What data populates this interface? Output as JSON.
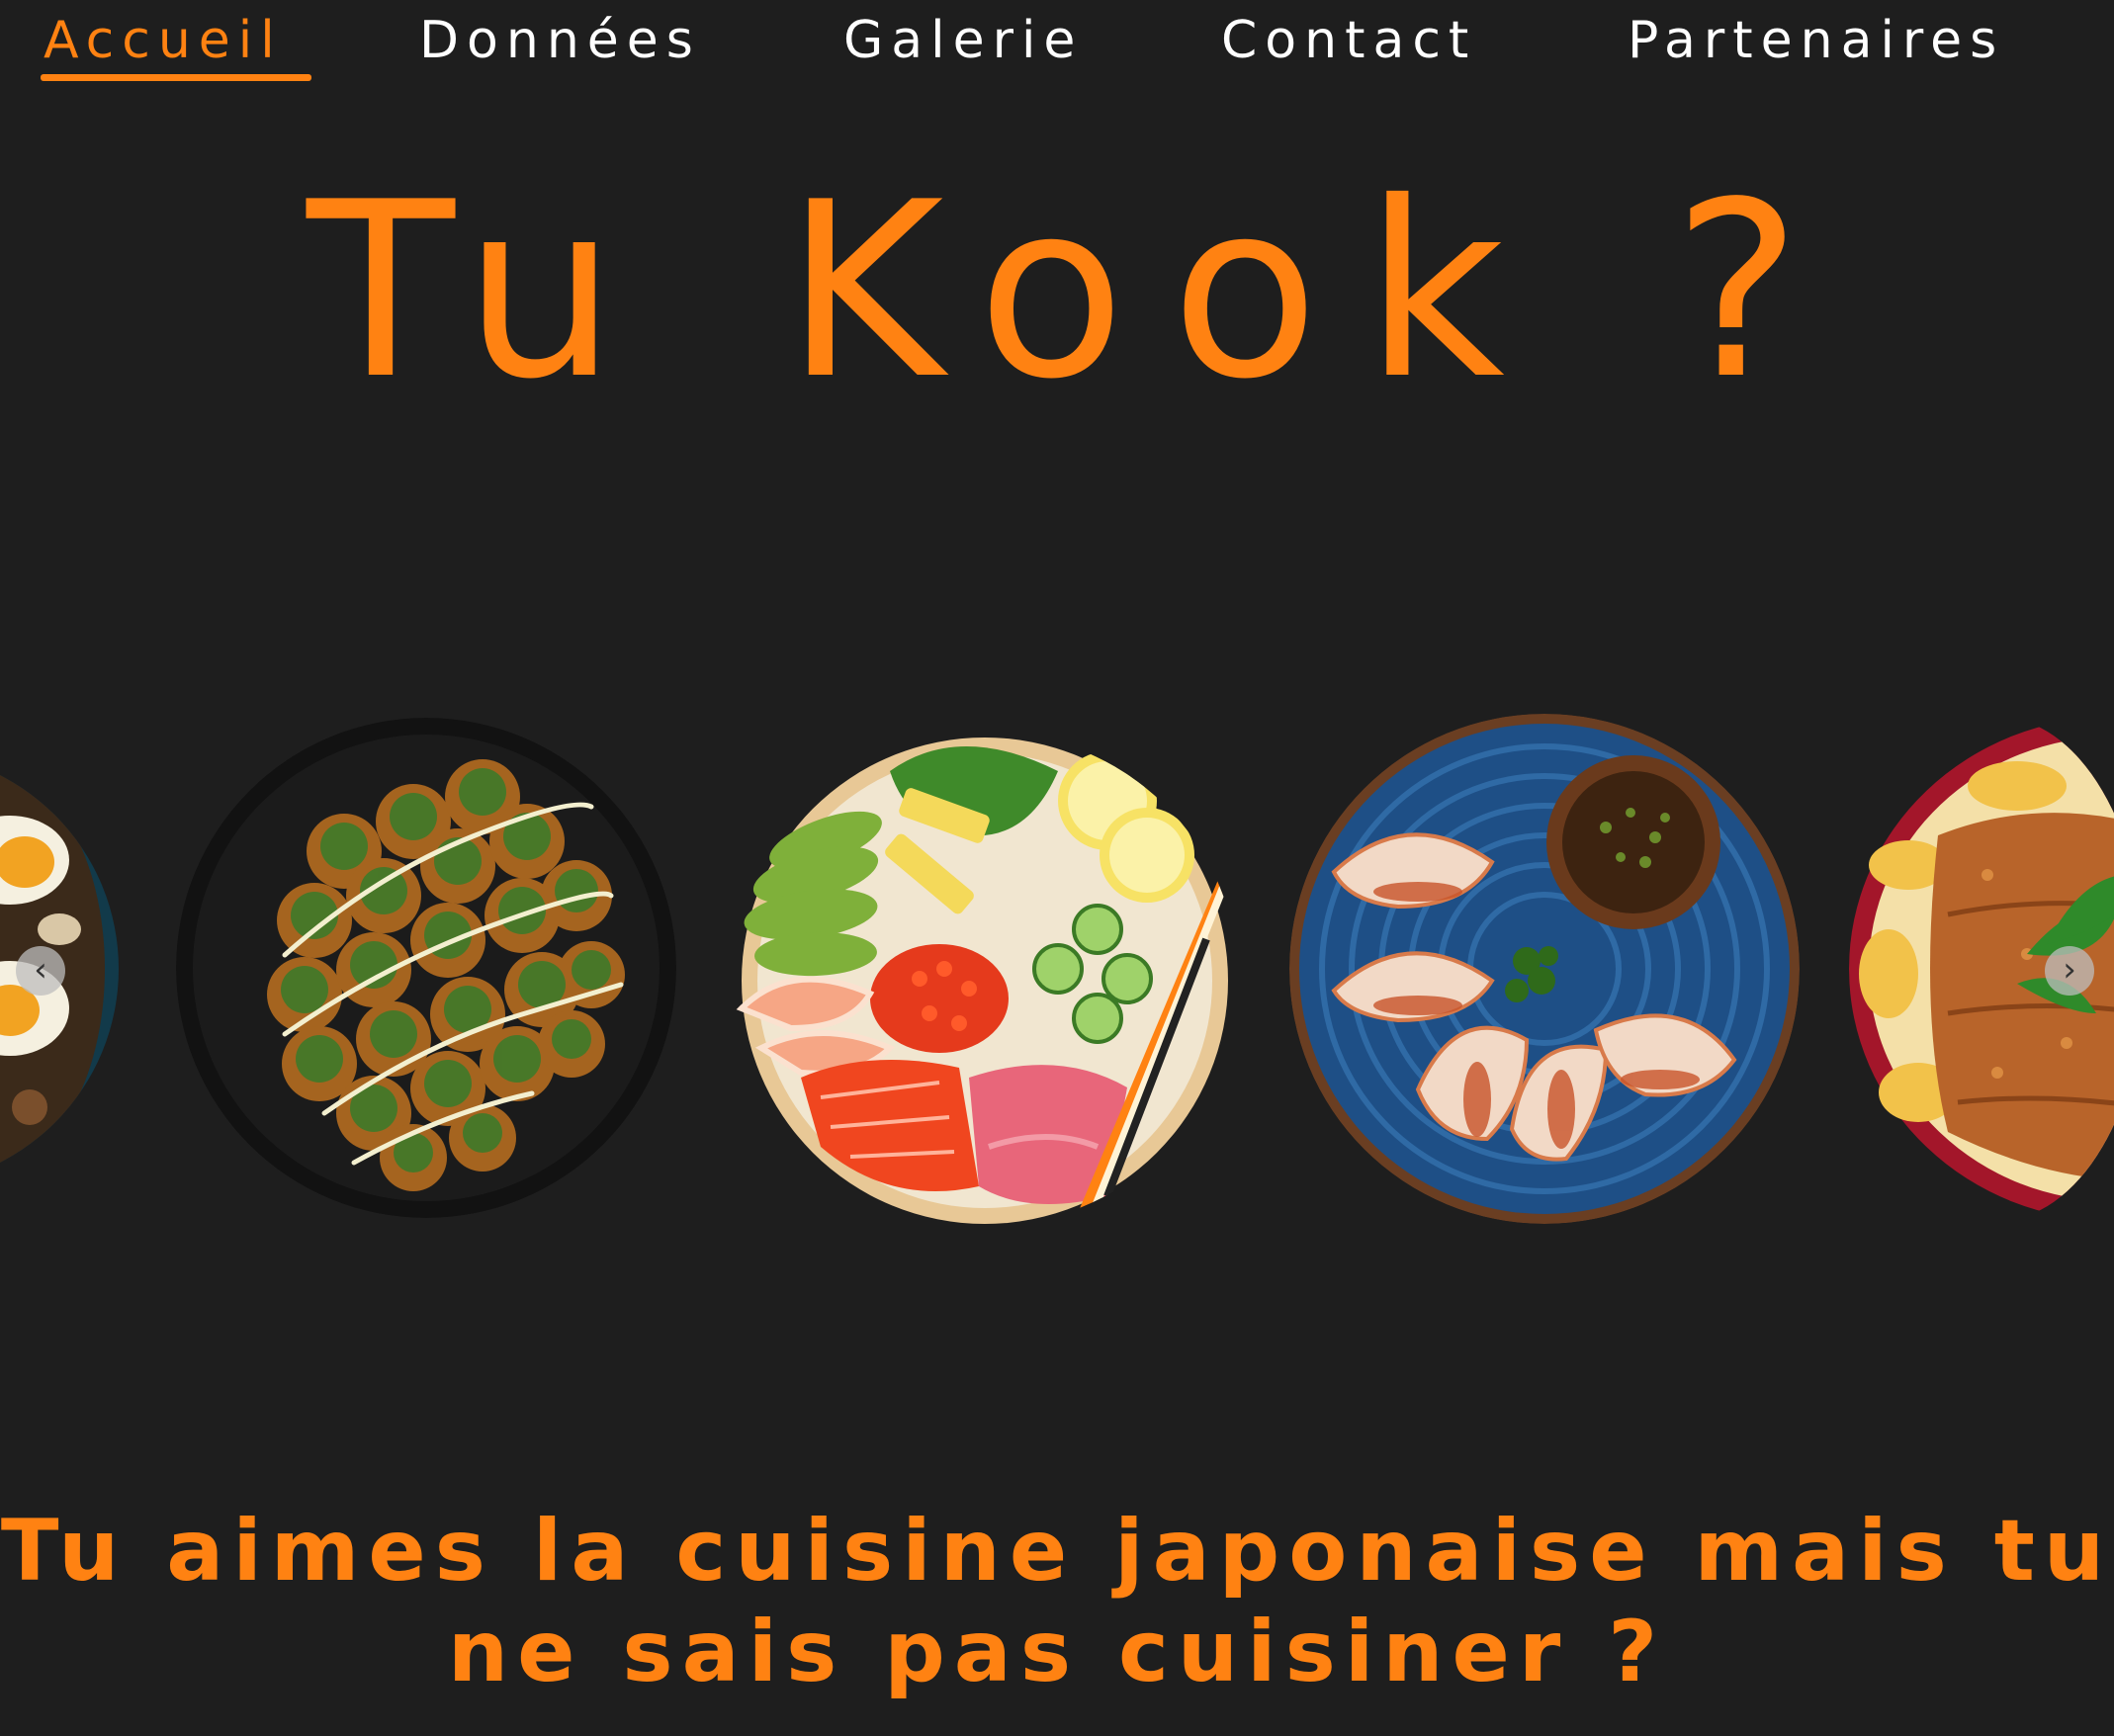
{
  "nav": {
    "items": [
      {
        "label": "Accueil",
        "active": true
      },
      {
        "label": "Données",
        "active": false
      },
      {
        "label": "Galerie",
        "active": false
      },
      {
        "label": "Contact",
        "active": false
      },
      {
        "label": "Partenaires",
        "active": false
      }
    ]
  },
  "hero": {
    "title": "Tu Kook ?"
  },
  "carousel": {
    "prev_icon": "chevron-left-icon",
    "next_icon": "chevron-right-icon",
    "prev_glyph": "‹",
    "next_glyph": "›"
  },
  "tagline": {
    "line1": "Tu aimes la cuisine japonaise mais tu",
    "line2": "ne sais pas cuisiner ?"
  },
  "colors": {
    "background": "#1e1e1e",
    "accent": "#ff8212",
    "nav_text": "#ffffff"
  }
}
